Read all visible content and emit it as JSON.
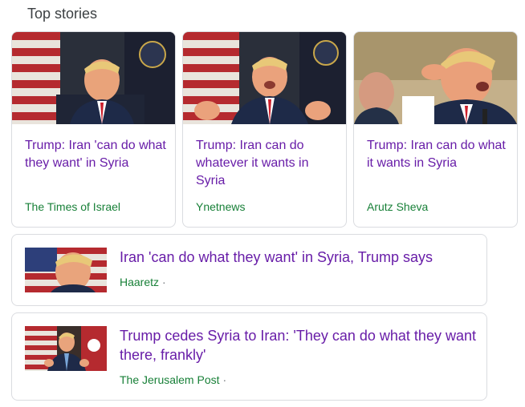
{
  "section": {
    "title": "Top stories"
  },
  "cards": [
    {
      "headline": "Trump: Iran 'can do what they want' in Syria",
      "source": "The Times of Israel"
    },
    {
      "headline": "Trump: Iran can do whatever it wants in Syria",
      "source": "Ynetnews"
    },
    {
      "headline": "Trump: Iran can do what it wants in Syria",
      "source": "Arutz Sheva"
    }
  ],
  "rows": [
    {
      "headline": "Iran 'can do what they want' in Syria, Trump says",
      "source": "Haaretz",
      "separator": "·"
    },
    {
      "headline": "Trump cedes Syria to Iran: 'They can do what they want there, frankly'",
      "source": "The Jerusalem Post",
      "separator": "·"
    }
  ],
  "colors": {
    "headline_visited": "#681da8",
    "source_green": "#188038",
    "border": "#dadce0"
  }
}
